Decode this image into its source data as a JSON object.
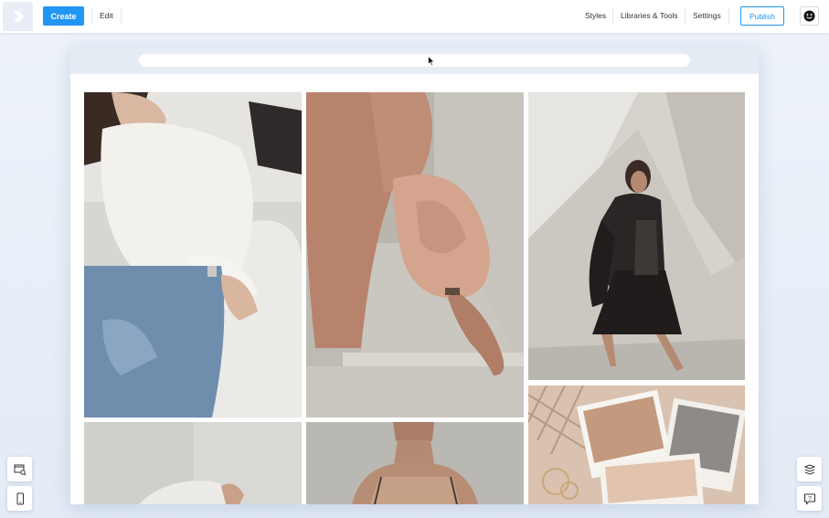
{
  "topbar": {
    "create_label": "Create",
    "edit_label": "Edit",
    "styles_label": "Styles",
    "libraries_label": "Libraries & Tools",
    "settings_label": "Settings",
    "publish_label": "Publish"
  },
  "colors": {
    "accent": "#2196f3",
    "topbar_bg": "#ffffff",
    "canvas_bg": "#e3ebf6"
  },
  "gallery": {
    "photos": [
      {
        "name": "photo-woman-white-shirt-jeans"
      },
      {
        "name": "photo-peach-sleeve-arm"
      },
      {
        "name": "photo-woman-leather-jacket"
      },
      {
        "name": "photo-polaroid-prints-collage"
      },
      {
        "name": "photo-partial-white-fabric"
      },
      {
        "name": "photo-partial-woman-portrait"
      }
    ]
  },
  "icons": {
    "logo": "chevron-logo-icon",
    "avatar": "smiley-avatar-icon",
    "search_layout": "layout-search-icon",
    "mobile": "mobile-device-icon",
    "layers": "layers-icon",
    "help": "help-chat-icon",
    "cursor": "mouse-cursor-icon"
  }
}
